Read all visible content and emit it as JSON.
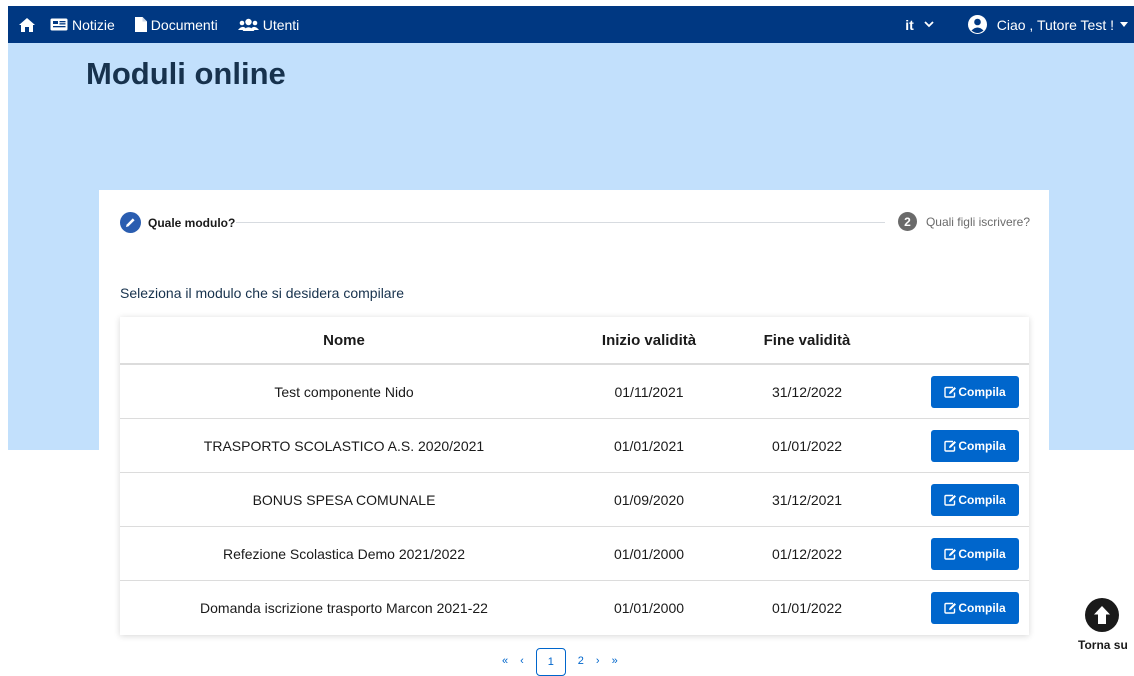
{
  "nav": {
    "home_icon": "home-icon",
    "items": [
      {
        "label": "Notizie",
        "icon": "newspaper-icon"
      },
      {
        "label": "Documenti",
        "icon": "file-icon"
      },
      {
        "label": "Utenti",
        "icon": "users-icon"
      }
    ],
    "language": "it",
    "user_greeting": "Ciao , Tutore Test !"
  },
  "page": {
    "title": "Moduli online"
  },
  "stepper": {
    "step1_label": "Quale modulo?",
    "step2_number": "2",
    "step2_label": "Quali figli iscrivere?"
  },
  "instruction": "Seleziona il modulo che si desidera compilare",
  "table": {
    "headers": {
      "name": "Nome",
      "start": "Inizio validità",
      "end": "Fine validità"
    },
    "rows": [
      {
        "name": "Test componente Nido",
        "start": "01/11/2021",
        "end": "31/12/2022",
        "action": "Compila"
      },
      {
        "name": "TRASPORTO SCOLASTICO A.S. 2020/2021",
        "start": "01/01/2021",
        "end": "01/01/2022",
        "action": "Compila"
      },
      {
        "name": "BONUS SPESA COMUNALE",
        "start": "01/09/2020",
        "end": "31/12/2021",
        "action": "Compila"
      },
      {
        "name": "Refezione Scolastica Demo 2021/2022",
        "start": "01/01/2000",
        "end": "01/12/2022",
        "action": "Compila"
      },
      {
        "name": "Domanda iscrizione trasporto Marcon 2021-22",
        "start": "01/01/2000",
        "end": "01/01/2022",
        "action": "Compila"
      }
    ]
  },
  "pagination": {
    "first": "«",
    "prev": "‹",
    "pages": [
      "1",
      "2"
    ],
    "current": "1",
    "next": "›",
    "last": "»"
  },
  "back_to_top": "Torna su",
  "colors": {
    "navbar": "#003882",
    "hero": "#c2e0fc",
    "primary": "#0066cc",
    "title": "#17324d"
  }
}
